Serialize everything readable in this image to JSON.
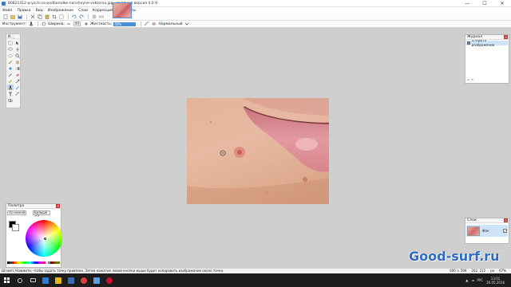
{
  "window": {
    "title": "80821412-prysch-na-podborodke-narisheyne-vektorna.jpg - paint.net версия 4.0.9",
    "controls": [
      "—",
      "☐",
      "✕"
    ]
  },
  "menu": [
    "Файл",
    "Правка",
    "Вид",
    "Изображение",
    "Слои",
    "Коррекция",
    "Эффекты"
  ],
  "toolbar2": {
    "tool_label": "Инструмент:",
    "width_label": "Ширина:",
    "width_value": "40",
    "hardness_label": "Жесткость:",
    "hardness_value": "50%",
    "blend_label": "Нормальный"
  },
  "tools_panel": {
    "title": "И..."
  },
  "history": {
    "title": "Журнал",
    "items": [
      "Открыть изображение"
    ]
  },
  "layers": {
    "title": "Слои",
    "items": [
      {
        "name": "Фон",
        "visible": true
      }
    ]
  },
  "palette": {
    "title": "Палитра",
    "mode": "Основной",
    "more_button": "Больше >>",
    "primary_color": "#000000",
    "secondary_color": "#ffffff"
  },
  "status": {
    "message": "Штамп: Нажмите, чтобы задать точку привязки. Затем нажатие левой кнопки мыши будет копировать изображение около точки.",
    "image_size": "600 × 599",
    "cursor_pos": "202, 212",
    "units": "px",
    "zoom": "67%"
  },
  "taskbar": {
    "language": "РУС",
    "time": "13:01",
    "date": "26.05.2016"
  },
  "watermark": "Good-surf.ru",
  "colors": {
    "accent": "#4a90d9",
    "selection": "#cfe3f7",
    "canvas_bg": "#cfcfcf",
    "taskbar": "#1d1d1d"
  }
}
